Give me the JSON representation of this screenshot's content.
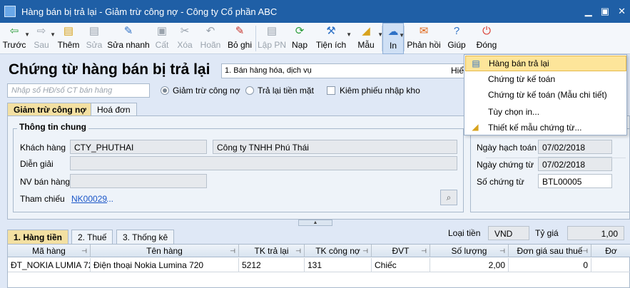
{
  "window": {
    "title": "Hàng bán bị trả lại - Giảm trừ công nợ - Công ty Cổ phần ABC"
  },
  "toolbar": {
    "items": [
      {
        "label": "Trước",
        "icon": "arrow-left-icon",
        "glyph": "⇦",
        "color": "#2b9d3a",
        "enabled": true,
        "dropdown": true
      },
      {
        "label": "Sau",
        "icon": "arrow-right-icon",
        "glyph": "⇨",
        "color": "#9aa3ad",
        "enabled": false,
        "dropdown": true
      },
      {
        "label": "Thêm",
        "icon": "add-document-icon",
        "glyph": "▤",
        "color": "#d8a31d",
        "enabled": true
      },
      {
        "label": "Sửa",
        "icon": "edit-document-icon",
        "glyph": "▤",
        "color": "#9aa3ad",
        "enabled": false
      },
      {
        "label": "Sửa nhanh",
        "icon": "quick-edit-icon",
        "glyph": "✎",
        "color": "#2f72c6",
        "enabled": true
      },
      {
        "label": "Cất",
        "icon": "save-icon",
        "glyph": "▣",
        "color": "#9aa3ad",
        "enabled": false
      },
      {
        "label": "Xóa",
        "icon": "delete-icon",
        "glyph": "✂",
        "color": "#9aa3ad",
        "enabled": false
      },
      {
        "label": "Hoãn",
        "icon": "undo-icon",
        "glyph": "↶",
        "color": "#9aa3ad",
        "enabled": false
      },
      {
        "label": "Bỏ ghi",
        "icon": "unpost-icon",
        "glyph": "✎",
        "color": "#c8362e",
        "enabled": true
      },
      {
        "label": "Lập PN",
        "icon": "create-receipt-icon",
        "glyph": "▤",
        "color": "#9aa3ad",
        "enabled": false
      },
      {
        "label": "Nạp",
        "icon": "refresh-icon",
        "glyph": "⟳",
        "color": "#2b9d3a",
        "enabled": true
      },
      {
        "label": "Tiện ích",
        "icon": "utilities-icon",
        "glyph": "⚒",
        "color": "#2f72c6",
        "enabled": true,
        "dropdown": true
      },
      {
        "label": "Mẫu",
        "icon": "template-icon",
        "glyph": "◢",
        "color": "#d8a31d",
        "enabled": true,
        "dropdown": true
      },
      {
        "label": "In",
        "icon": "print-icon",
        "glyph": "☁",
        "color": "#2f72c6",
        "enabled": true,
        "dropdown": true,
        "active": true
      },
      {
        "label": "Phản hồi",
        "icon": "feedback-icon",
        "glyph": "✉",
        "color": "#e06a1e",
        "enabled": true
      },
      {
        "label": "Giúp",
        "icon": "help-icon",
        "glyph": "?",
        "color": "#2f72c6",
        "enabled": true
      },
      {
        "label": "Đóng",
        "icon": "close-icon",
        "glyph": "⏻",
        "color": "#d93a2f",
        "enabled": true
      }
    ]
  },
  "header": {
    "title": "Chứng từ hàng bán bị trả lại",
    "type_value": "1. Bán hàng hóa, dịch vụ",
    "truncated_label": "Hiể",
    "ref_placeholder": "Nhập số HĐ/số CT bán hàng",
    "radio_reduce": "Giảm trừ công nợ",
    "radio_cash": "Trả lại tiền mặt",
    "check_receipt": "Kiêm phiếu nhập kho"
  },
  "tabs": [
    {
      "label": "Giảm trừ công nợ",
      "active": true
    },
    {
      "label": "Hoá đơn",
      "active": false
    }
  ],
  "general": {
    "group_title": "Thông tin chung",
    "customer_label": "Khách hàng",
    "customer_code": "CTY_PHUTHAI",
    "customer_name": "Công ty TNHH Phú Thái",
    "desc_label": "Diễn giải",
    "salesperson_label": "NV bán hàng",
    "ref_label": "Tham chiếu",
    "ref_link": "NK00029",
    "ref_more": "..."
  },
  "voucher": {
    "post_date_label": "Ngày hạch toán",
    "post_date": "07/02/2018",
    "doc_date_label": "Ngày chứng từ",
    "doc_date": "07/02/2018",
    "doc_no_label": "Số chứng từ",
    "doc_no": "BTL00005"
  },
  "bottom_tabs": [
    {
      "label": "1. Hàng tiền",
      "active": true
    },
    {
      "label": "2. Thuế",
      "active": false
    },
    {
      "label": "3. Thống kê",
      "active": false
    }
  ],
  "currency": {
    "label": "Loại tiền",
    "value": "VND",
    "rate_label": "Tỷ giá",
    "rate": "1,00"
  },
  "grid": {
    "columns": [
      "Mã hàng",
      "Tên hàng",
      "TK trả lại",
      "TK công nợ",
      "ĐVT",
      "Số lượng",
      "Đơn giá sau thuế",
      "Đơ"
    ],
    "rows": [
      [
        "ĐT_NOKIA LUMIA 72",
        "Điện thoại Nokia Lumina 720",
        "5212",
        "131",
        "Chiếc",
        "2,00",
        "0",
        ""
      ]
    ]
  },
  "print_menu": {
    "items": [
      {
        "label": "Hàng bán trả lại",
        "icon": "document-icon",
        "highlighted": true
      },
      {
        "label": "Chứng từ kế toán",
        "icon": "",
        "highlighted": false
      },
      {
        "label": "Chứng từ kế toán (Mẫu chi tiết)",
        "icon": "",
        "highlighted": false
      },
      {
        "label": "Tùy chọn in...",
        "icon": "",
        "highlighted": false
      },
      {
        "label": "Thiết kế mẫu chứng từ...",
        "icon": "template-design-icon",
        "highlighted": false
      }
    ]
  }
}
